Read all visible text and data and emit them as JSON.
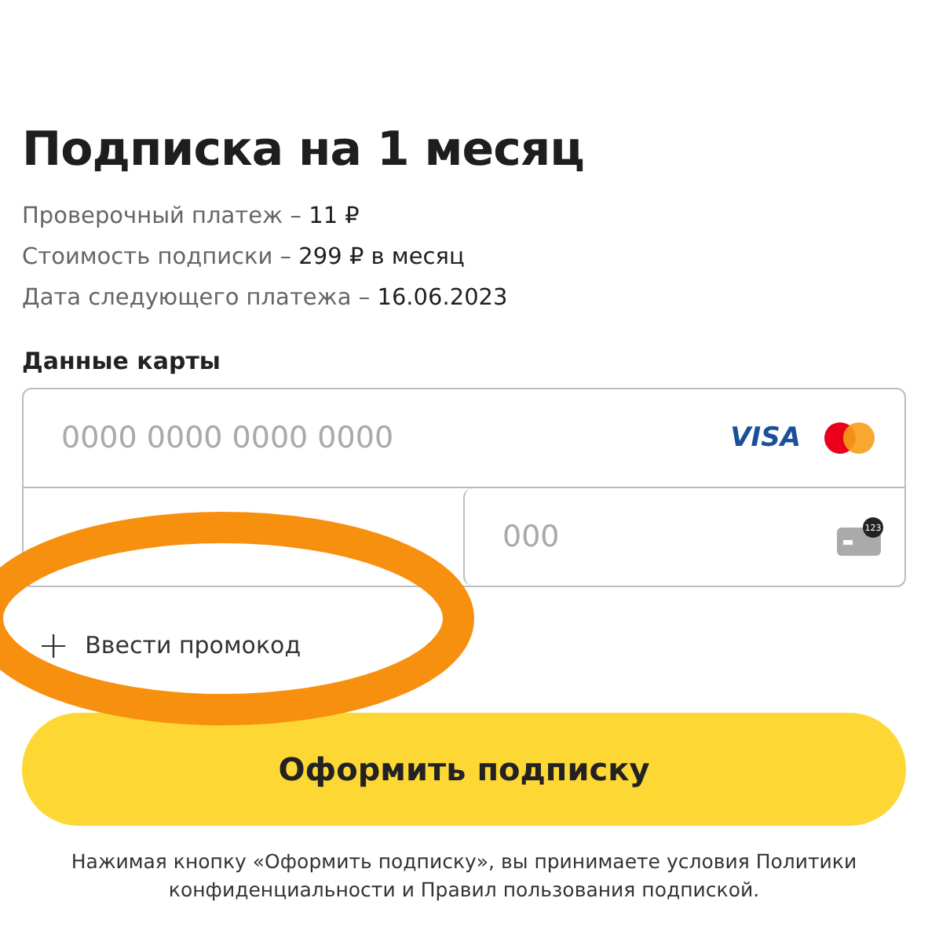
{
  "title": "Подписка на 1 месяц",
  "details": [
    {
      "label": "Проверочный платеж – ",
      "value": "11 ₽"
    },
    {
      "label": "Стоимость подписки – ",
      "value": "299 ₽ в месяц"
    },
    {
      "label": "Дата следующего платежа – ",
      "value": "16.06.2023"
    }
  ],
  "card_section": {
    "label": "Данные карты",
    "card_number": {
      "placeholder": "0000 0000 0000 0000"
    },
    "brand_text": "VISA",
    "cvc": {
      "placeholder": "000"
    },
    "cvc_badge": "123"
  },
  "promo_link": {
    "icon": "+",
    "label": "Ввести промокод"
  },
  "submit_button": "Оформить подписку",
  "disclaimer": "Нажимая кнопку «Оформить подписку», вы принимаете условия Политики конфиденциальности и Правил пользования подпиской."
}
